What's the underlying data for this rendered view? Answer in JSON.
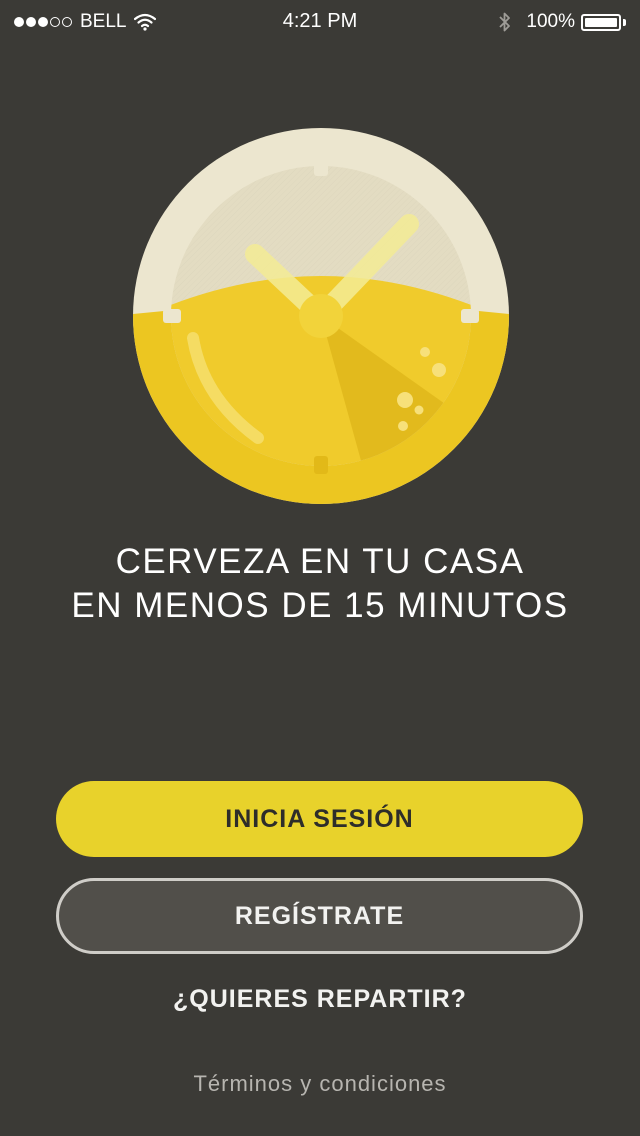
{
  "status_bar": {
    "signal_full": 3,
    "signal_empty": 2,
    "carrier": "BELL",
    "time": "4:21 PM",
    "battery_percent": "100%",
    "icons": [
      "wifi-icon",
      "bluetooth-icon",
      "battery-icon"
    ]
  },
  "logo": {
    "icon": "beer-clock-icon",
    "colors": {
      "rim": "#ece6cf",
      "beer": "#f0cb2c",
      "beer_dark": "#d7ad12",
      "hands": "#f4ec95"
    }
  },
  "tagline": {
    "line1": "CERVEZA EN TU CASA",
    "line2": "EN MENOS DE 15 MINUTOS"
  },
  "actions": {
    "login_label": "INICIA SESIÓN",
    "register_label": "REGÍSTRATE",
    "deliver_label": "¿QUIERES REPARTIR?",
    "terms_label": "Términos y condiciones"
  },
  "colors": {
    "background": "#3b3a36",
    "accent": "#e8d22b",
    "secondary_button": "#514f4a"
  }
}
